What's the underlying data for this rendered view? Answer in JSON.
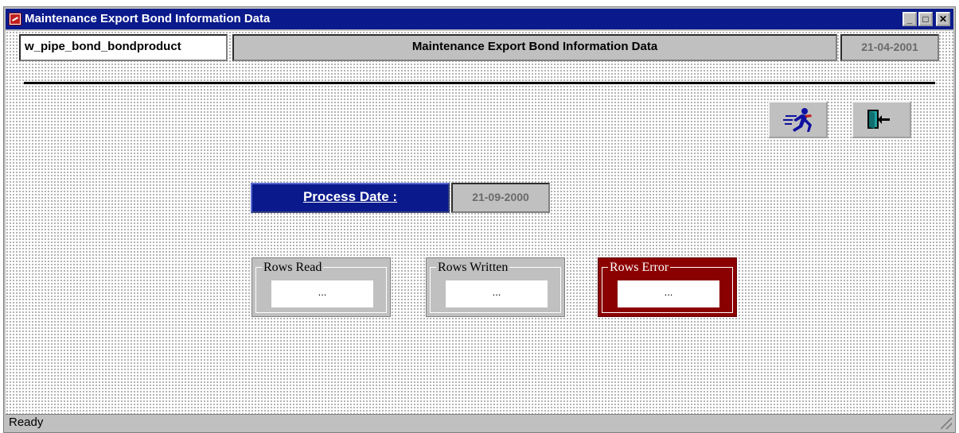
{
  "window": {
    "title": "Maintenance Export Bond Information Data"
  },
  "titlebar_buttons": {
    "minimize": "_",
    "maximize": "□",
    "close": "✕"
  },
  "header": {
    "object_name": "w_pipe_bond_bondproduct",
    "title": "Maintenance Export Bond Information Data",
    "date": "21-04-2001"
  },
  "toolbar": {
    "run_icon": "running-man-icon",
    "exit_icon": "exit-door-icon"
  },
  "process": {
    "label": "Process Date :",
    "value": "21-09-2000"
  },
  "counters": [
    {
      "label": "Rows Read",
      "value": "..."
    },
    {
      "label": "Rows Written",
      "value": "..."
    },
    {
      "label": "Rows Error",
      "value": "..."
    }
  ],
  "status": {
    "text": "Ready"
  },
  "colors": {
    "titlebar": "#0a1a8c",
    "error_box": "#8b0000",
    "panel": "#c0c0c0"
  }
}
